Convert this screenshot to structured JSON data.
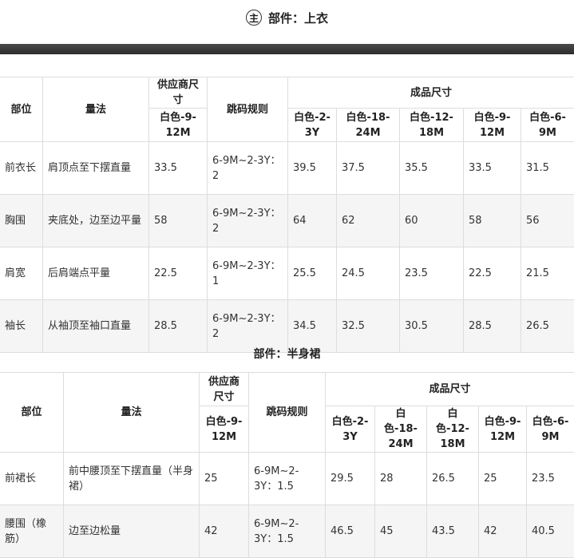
{
  "header": {
    "badge": "主",
    "title": "部件：上衣"
  },
  "table1": {
    "h_part": "部位",
    "h_method": "量法",
    "h_supplier": "供应商尺寸",
    "h_rule": "跳码规则",
    "h_finished": "成品尺寸",
    "sizes": [
      "白色-9-12M",
      "白色-2-3Y",
      "白色-18-24M",
      "白色-12-18M",
      "白色-9-12M",
      "白色-6-9M"
    ],
    "rows": [
      {
        "part": "前衣长",
        "method": "肩顶点至下摆直量",
        "supplier": "33.5",
        "rule": "6-9M~2-3Y：2",
        "values": [
          "39.5",
          "37.5",
          "35.5",
          "33.5",
          "31.5"
        ]
      },
      {
        "part": "胸围",
        "method": "夹底处，边至边平量",
        "supplier": "58",
        "rule": "6-9M~2-3Y：2",
        "values": [
          "64",
          "62",
          "60",
          "58",
          "56"
        ]
      },
      {
        "part": "肩宽",
        "method": "后肩端点平量",
        "supplier": "22.5",
        "rule": "6-9M~2-3Y：1",
        "values": [
          "25.5",
          "24.5",
          "23.5",
          "22.5",
          "21.5"
        ]
      },
      {
        "part": "袖长",
        "method": "从袖顶至袖口直量",
        "supplier": "28.5",
        "rule": "6-9M~2-3Y：2",
        "values": [
          "34.5",
          "32.5",
          "30.5",
          "28.5",
          "26.5"
        ]
      }
    ]
  },
  "section2": {
    "title": "部件：半身裙"
  },
  "table2": {
    "h_part": "部位",
    "h_method": "量法",
    "h_supplier": "供应商尺寸",
    "h_rule": "跳码规则",
    "h_finished": "成品尺寸",
    "sizes": [
      "白色-9-12M",
      "白色-2-3Y",
      "白色-18-24M",
      "白色-12-18M",
      "白色-9-12M",
      "白色-6-9M"
    ],
    "rows": [
      {
        "part": "前裙长",
        "method": "前中腰顶至下摆直量（半身裙）",
        "supplier": "25",
        "rule": "6-9M~2-3Y：1.5",
        "values": [
          "29.5",
          "28",
          "26.5",
          "25",
          "23.5"
        ]
      },
      {
        "part": "腰围（橡筋）",
        "method": "边至边松量",
        "supplier": "42",
        "rule": "6-9M~2-3Y：1.5",
        "values": [
          "46.5",
          "45",
          "43.5",
          "42",
          "40.5"
        ]
      }
    ]
  }
}
